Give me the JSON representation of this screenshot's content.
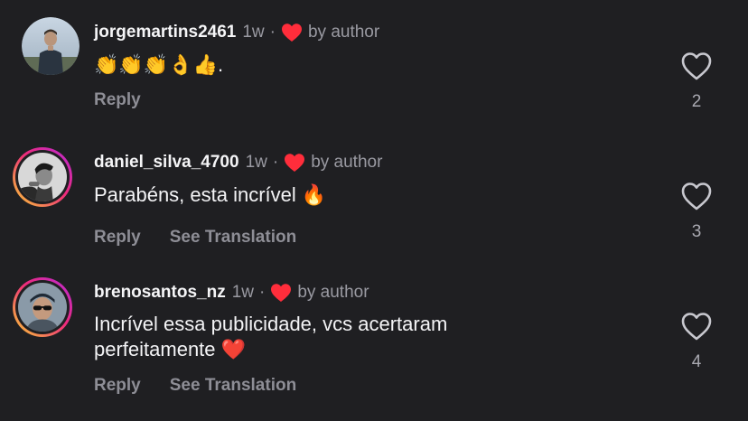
{
  "comments": [
    {
      "username": "jorgemartins2461",
      "time": "1w",
      "separator": "·",
      "liked_by": "by author",
      "text": "👏👏👏👌👍.",
      "actions": {
        "reply": "Reply"
      },
      "like_count": "2"
    },
    {
      "username": "daniel_silva_4700",
      "time": "1w",
      "separator": "·",
      "liked_by": "by author",
      "text": "Parabéns, esta incrível 🔥",
      "actions": {
        "reply": "Reply",
        "translate": "See Translation"
      },
      "like_count": "3"
    },
    {
      "username": "brenosantos_nz",
      "time": "1w",
      "separator": "·",
      "liked_by": "by author",
      "text": "Incrível essa publicidade, vcs acertaram perfeitamente ❤️",
      "actions": {
        "reply": "Reply",
        "translate": "See Translation"
      },
      "like_count": "4"
    }
  ],
  "icons": {
    "author_heart": "heart-filled-icon",
    "like": "heart-outline-icon"
  },
  "colors": {
    "background": "#1f1f22",
    "author_heart": "#ff2d3b",
    "secondary_text": "#9a9aa2",
    "story_ring_start": "#f9ce34",
    "story_ring_end": "#b72ad9"
  }
}
